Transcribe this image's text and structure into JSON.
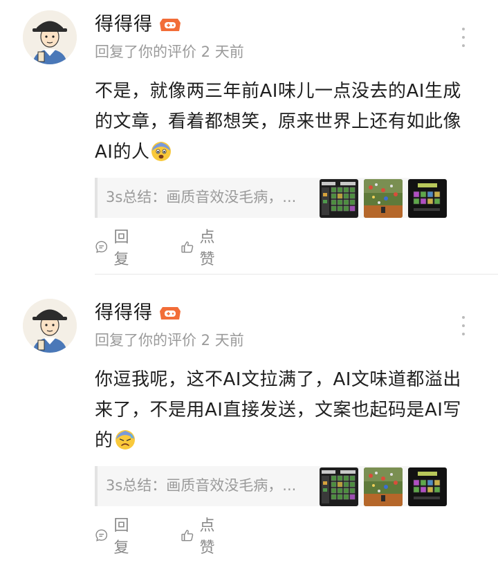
{
  "comments": [
    {
      "username": "得得得",
      "avatar_icon": "scholar-avatar-icon",
      "badge_icon": "game-controller-badge-icon",
      "badge_color": "#f26d38",
      "meta": "回复了你的评价 2 天前",
      "text": "不是，就像两三年前AI味儿一点没去的AI生成的文章，看着都想笑，原来世界上还有如此像AI的人",
      "emoji": "fearful-face-emoji",
      "preview": {
        "text": "3s总结：画质音效没毛病，...",
        "thumbnails": [
          "game-inventory-screenshot",
          "game-battlefield-screenshot",
          "game-menu-screenshot"
        ]
      },
      "reply_label": "回复",
      "like_label": "点赞"
    },
    {
      "username": "得得得",
      "avatar_icon": "scholar-avatar-icon",
      "badge_icon": "game-controller-badge-icon",
      "badge_color": "#f26d38",
      "meta": "回复了你的评价 2 天前",
      "text": "你逗我呢，这不AI文拉满了，AI文味道都溢出来了，不是用AI直接发送，文案也起码是AI写的",
      "emoji": "anxious-sweat-face-emoji",
      "preview": {
        "text": "3s总结：画质音效没毛病，...",
        "thumbnails": [
          "game-inventory-screenshot",
          "game-battlefield-screenshot",
          "game-menu-screenshot"
        ]
      },
      "reply_label": "回复",
      "like_label": "点赞"
    }
  ]
}
